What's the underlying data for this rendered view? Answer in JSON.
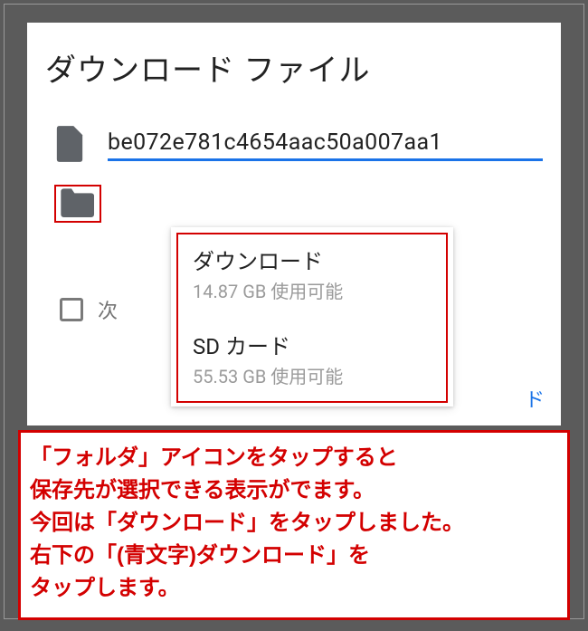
{
  "dialog": {
    "title": "ダウンロード ファイル",
    "filename": "be072e781c4654aac50a007aa1",
    "checkbox_label_partial": "次",
    "download_link_partial": "ド"
  },
  "dropdown": {
    "options": [
      {
        "title": "ダウンロード",
        "subtitle": "14.87 GB 使用可能"
      },
      {
        "title": "SD カード",
        "subtitle": "55.53 GB 使用可能"
      }
    ]
  },
  "annotation": {
    "line1": "「フォルダ」アイコンをタップすると",
    "line2": "保存先が選択できる表示がでます。",
    "line3": "今回は「ダウンロード」をタップしました。",
    "line4": "右下の「(青文字)ダウンロード」を",
    "line5": "タップします。"
  },
  "colors": {
    "accent_blue": "#1a73e8",
    "highlight_red": "#d30000"
  }
}
